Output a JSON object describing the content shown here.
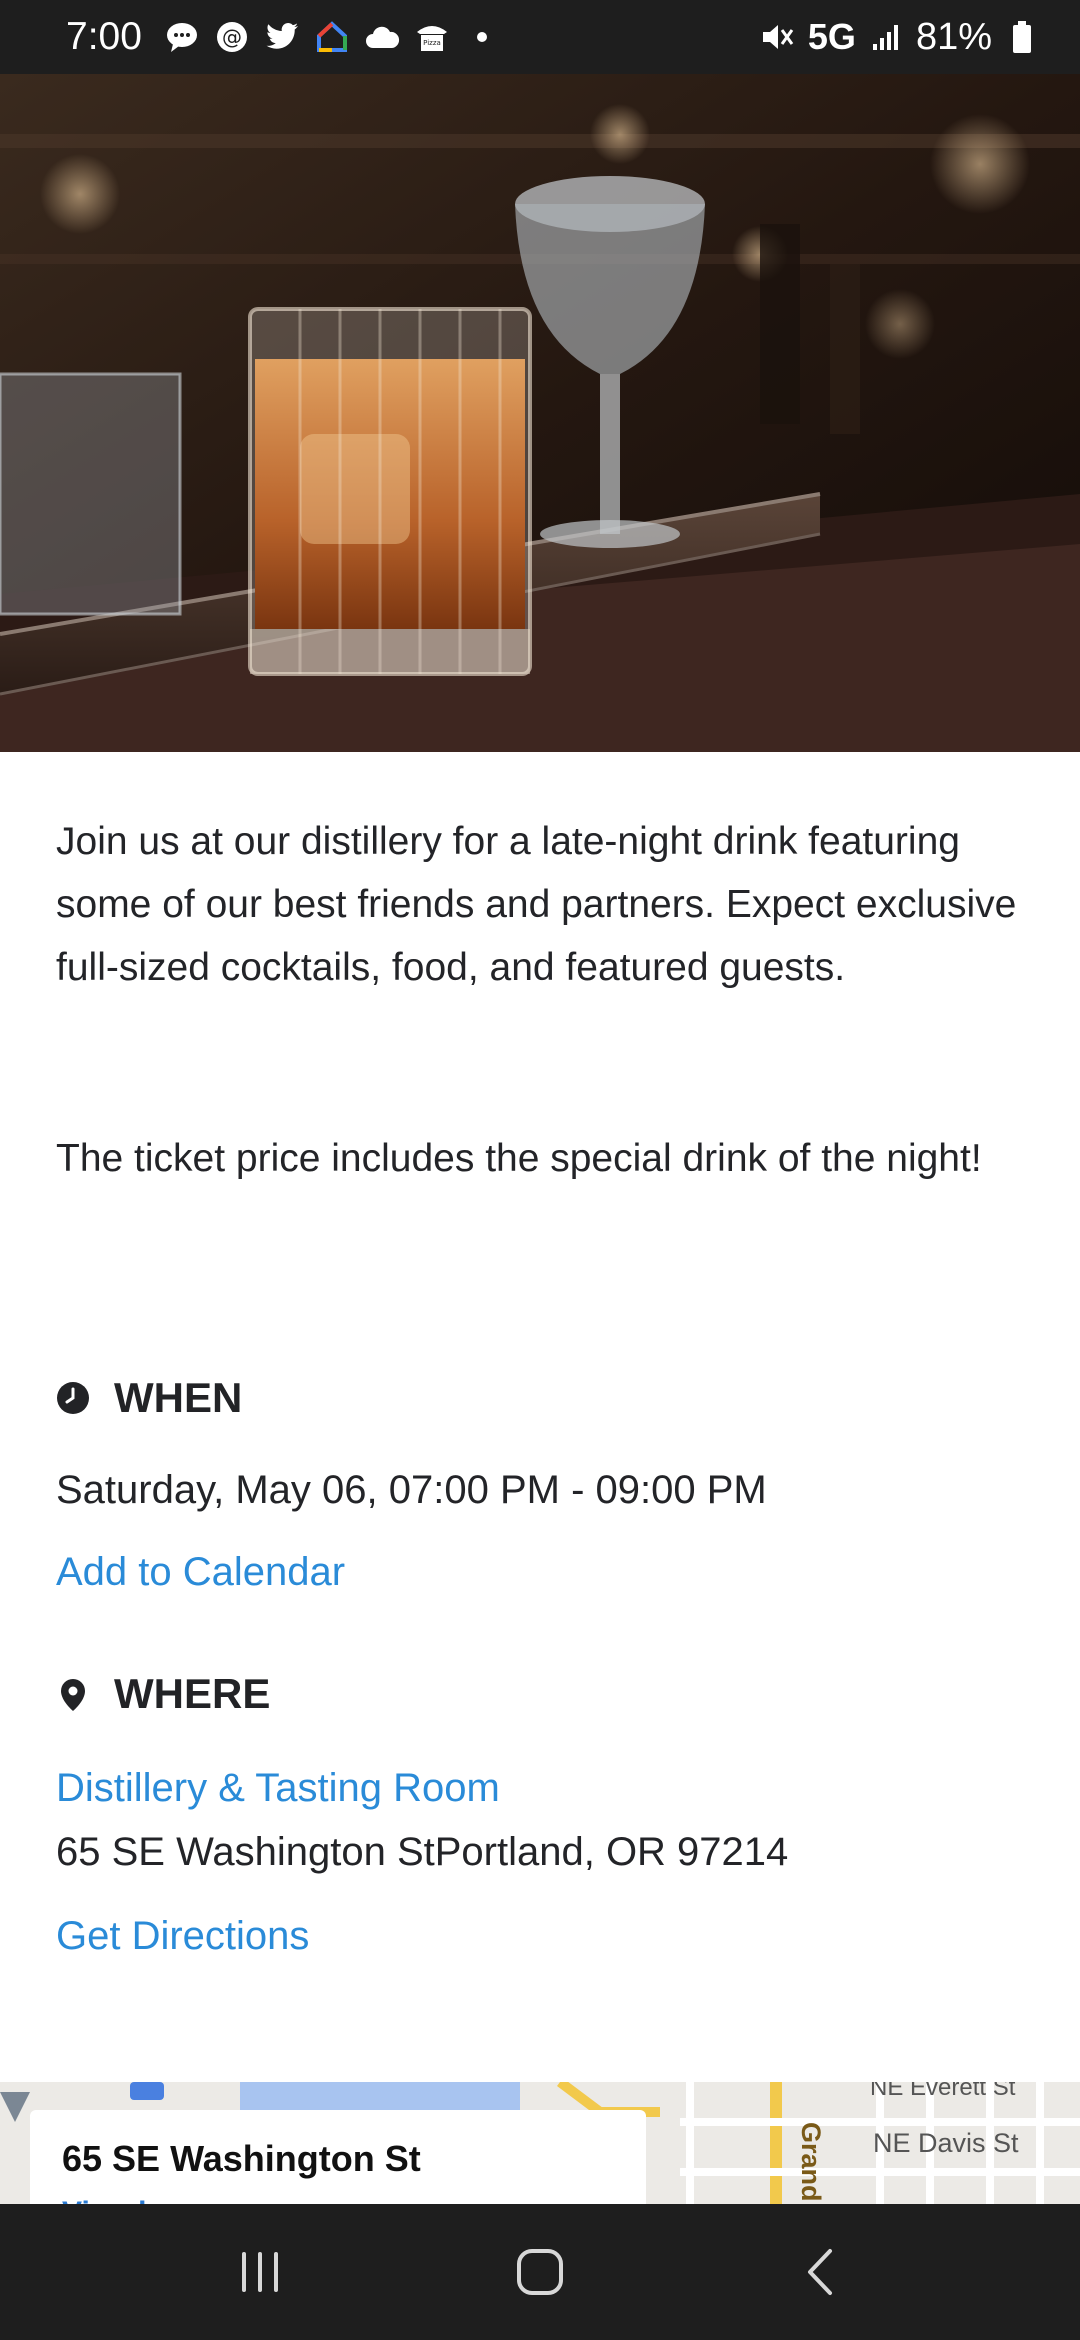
{
  "status_bar": {
    "time": "7:00",
    "network": "5G",
    "battery": "81%",
    "notification_icons": [
      "chat-icon",
      "threads-icon",
      "twitter-icon",
      "google-home-icon",
      "cloud-icon",
      "pizza-hut-icon",
      "dot-icon"
    ],
    "system_icons": [
      "mute-icon",
      "signal-icon",
      "battery-icon"
    ]
  },
  "hero": {
    "description": "cocktail-glass-on-bar-photo"
  },
  "event": {
    "description_p1": "Join us at our distillery for a late-night drink featuring some of our best friends and partners. Expect exclusive full-sized cocktails, food, and featured guests.",
    "description_p2": "The ticket price includes the special drink of the night!",
    "when_label": "WHEN",
    "when_value": "Saturday, May 06, 07:00 PM - 09:00 PM",
    "add_calendar": "Add to Calendar",
    "where_label": "WHERE",
    "venue": "Distillery & Tasting Room",
    "address": "65 SE Washington StPortland, OR 97214",
    "directions": "Get Directions"
  },
  "map": {
    "card_title": "65 SE Washington St",
    "card_sub": "View larger map",
    "street_1": "NE Davis St",
    "street_2": "Grand Av",
    "street_3": "NE Everett St"
  },
  "colors": {
    "link": "#2a8bd8",
    "status_bar": "#1e1e1e",
    "text": "#232428"
  }
}
